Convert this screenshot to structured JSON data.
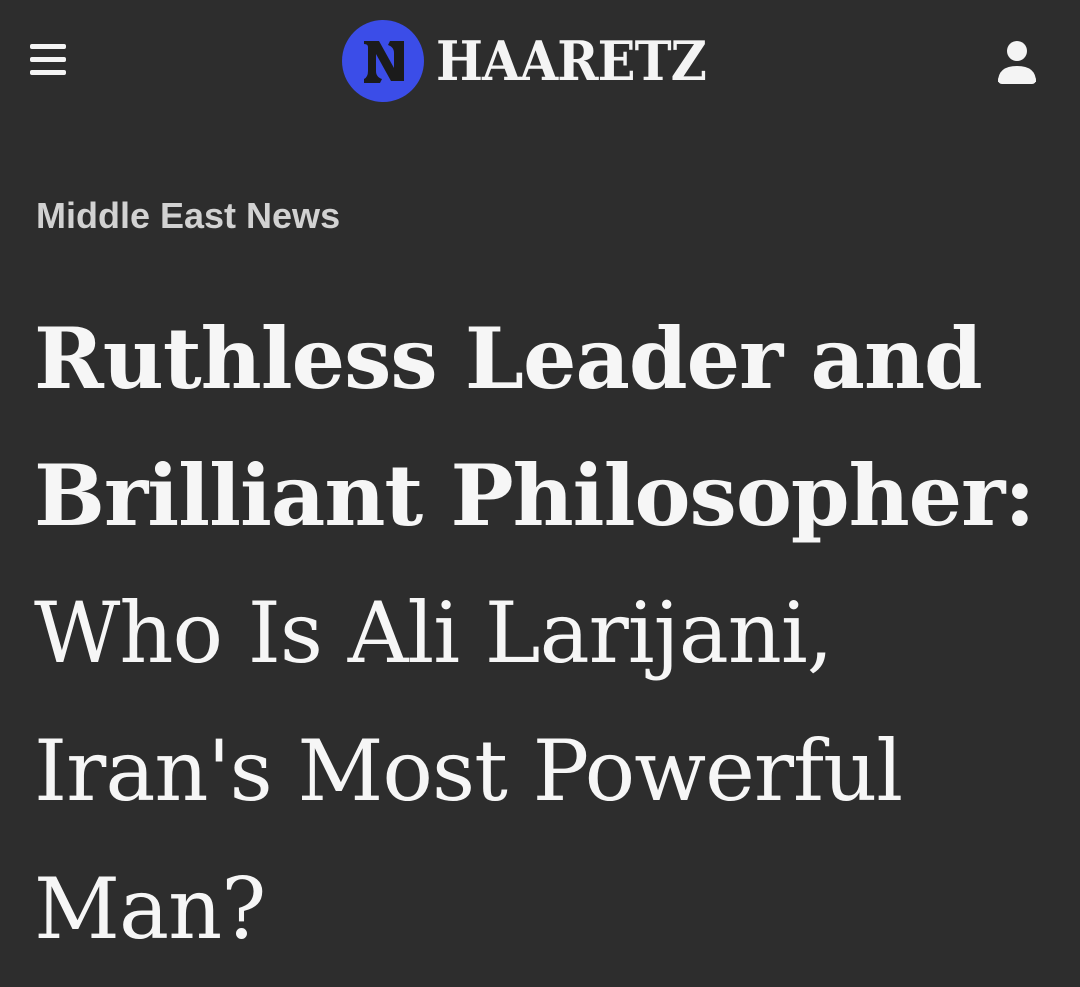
{
  "header": {
    "menu_icon": "hamburger-menu-icon",
    "logo_icon": "haaretz-logo-icon",
    "brand": "HAARETZ",
    "brand_color": "#3b4de8",
    "user_icon": "user-account-icon"
  },
  "article": {
    "section": "Middle East News",
    "headline_bold": "Ruthless Leader and Brilliant Philosopher:",
    "headline_regular": "Who Is Ali Larijani, Iran's Most Powerful Man?"
  },
  "colors": {
    "background": "#2d2d2d",
    "text": "#f4f4f4",
    "section_text": "#d2d2d2"
  }
}
